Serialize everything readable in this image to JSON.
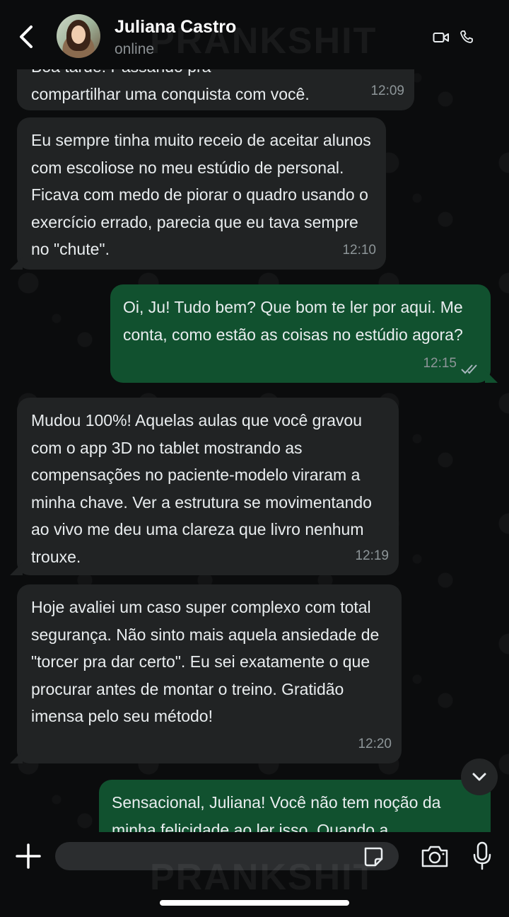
{
  "header": {
    "contact_name": "Juliana Castro",
    "status": "online",
    "icons": [
      "back-chevron-icon",
      "video-camera-icon",
      "phone-icon"
    ]
  },
  "watermark": "PRANKSHIT",
  "messages": [
    {
      "direction": "incoming",
      "text_partial_top": "Boa tarde! Passando pra",
      "text": "compartilhar uma conquista com você.",
      "time": "12:09"
    },
    {
      "direction": "incoming",
      "text": "Eu sempre tinha muito receio de aceitar alunos com escoliose no meu estúdio de personal. Ficava com medo de piorar o quadro usando o exercício errado, parecia que eu tava sempre no \"chute\".",
      "time": "12:10"
    },
    {
      "direction": "outgoing",
      "text": "Oi, Ju! Tudo bem? Que bom te ler por aqui. Me conta, como estão as coisas no estúdio agora?",
      "time": "12:15",
      "status": "read"
    },
    {
      "direction": "incoming",
      "text": "Mudou 100%! Aquelas aulas que você gravou com o app 3D no tablet mostrando as compensações no paciente-modelo viraram a minha chave. Ver a estrutura se movimentando ao vivo me deu uma clareza que livro nenhum trouxe.",
      "time": "12:19"
    },
    {
      "direction": "incoming",
      "text": "Hoje avaliei um caso super complexo com total segurança. Não sinto mais aquela ansiedade de \"torcer pra dar certo\". Eu sei exatamente o que procurar antes de montar o treino. Gratidão imensa pelo seu método!",
      "time": "12:20"
    },
    {
      "direction": "outgoing",
      "text": "Sensacional, Juliana! Você não tem noção da minha felicidade ao ler isso. Quando a"
    }
  ],
  "composer": {
    "placeholder": "",
    "icons": [
      "plus-icon",
      "sticker-icon",
      "camera-icon",
      "microphone-icon"
    ]
  },
  "colors": {
    "background": "#0b0c0d",
    "incoming_bubble": "#212324",
    "outgoing_bubble": "#11512f",
    "timestamp": "#8d9598"
  }
}
